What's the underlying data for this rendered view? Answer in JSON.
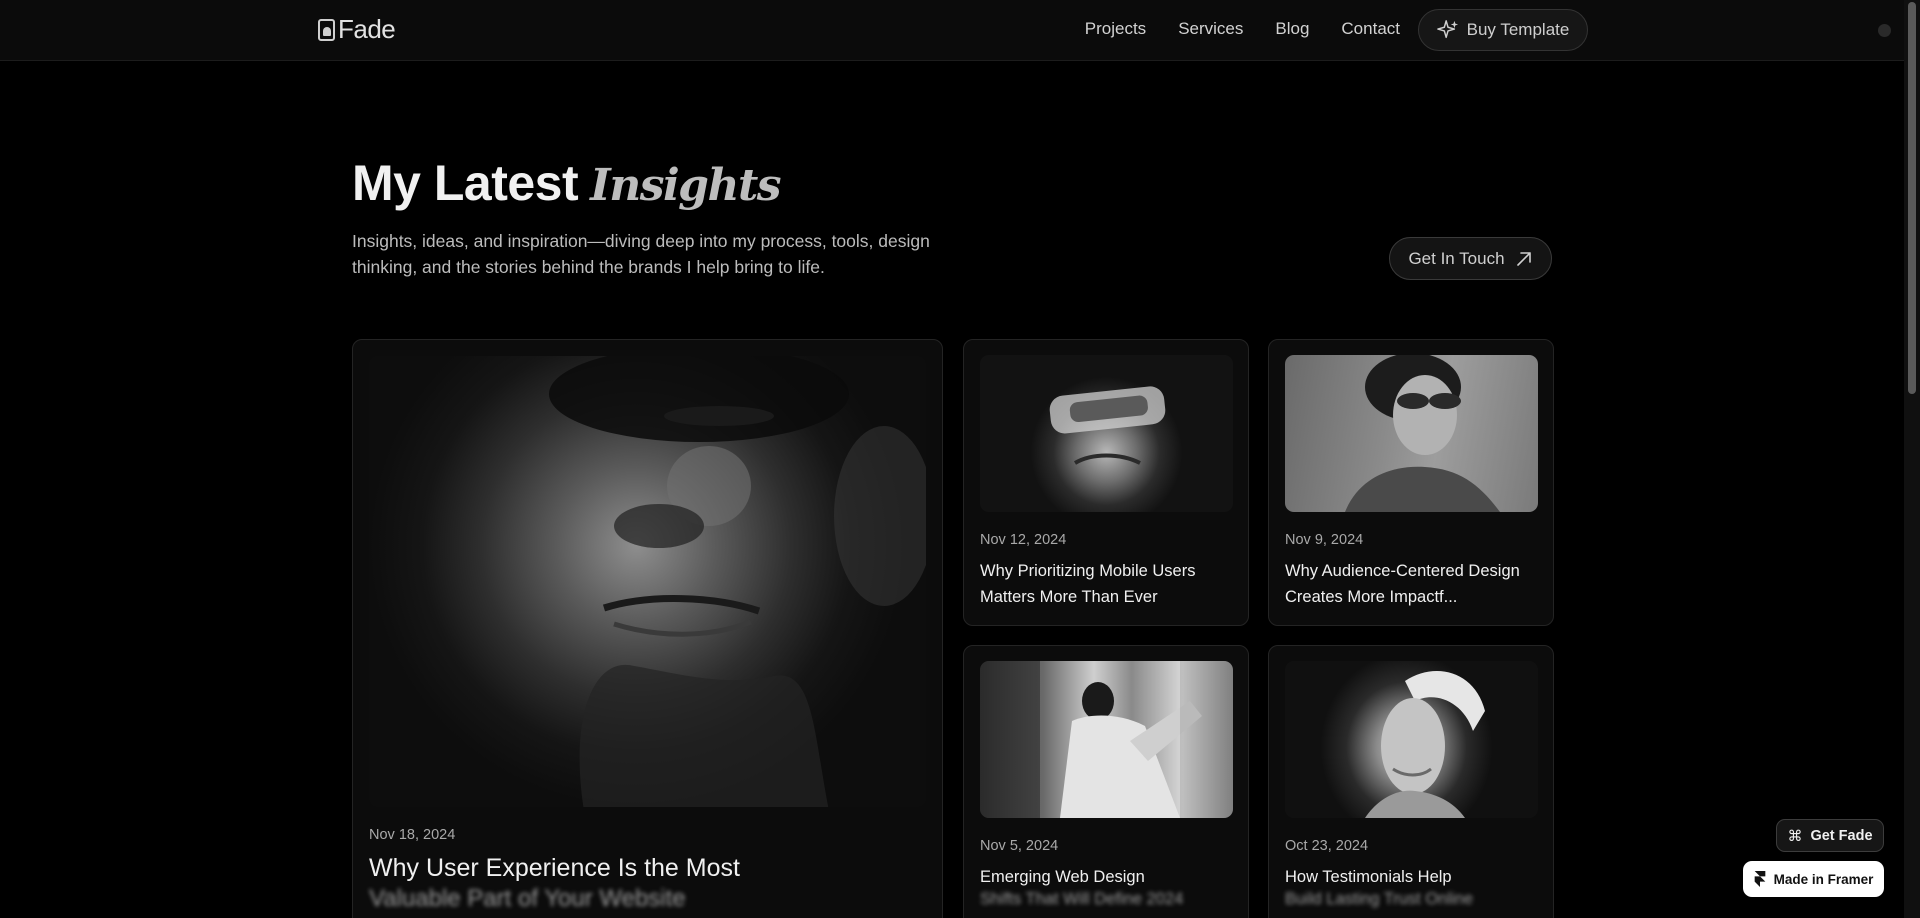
{
  "nav": {
    "logo_text": "Fade",
    "links": [
      "Projects",
      "Services",
      "Blog",
      "Contact"
    ],
    "buy_label": "Buy Template"
  },
  "header": {
    "title_plain": "My Latest",
    "title_accent": "Insights",
    "subtitle": "Insights, ideas, and inspiration—diving deep into my process, tools, design thinking, and the stories behind the brands I help bring to life.",
    "touch_label": "Get In Touch"
  },
  "posts": [
    {
      "date": "Nov 18, 2024",
      "title": "Why User Experience Is the Most",
      "title_faded": "Valuable Part of Your Website",
      "icon": "portrait-image"
    },
    {
      "date": "Nov 12, 2024",
      "title": "Why Prioritizing Mobile Users Matters More Than Ever",
      "icon": "visor-portrait-image"
    },
    {
      "date": "Nov 9, 2024",
      "title": "Why Audience-Centered Design Creates More Impactf...",
      "icon": "sunglasses-portrait-image"
    },
    {
      "date": "Nov 5, 2024",
      "title": "Emerging Web Design",
      "title_faded": "Shifts That Will Define 2024",
      "icon": "street-fashion-image"
    },
    {
      "date": "Oct 23, 2024",
      "title": "How Testimonials Help",
      "title_faded": "Build Lasting Trust Online",
      "icon": "bandana-portrait-image"
    }
  ],
  "badges": {
    "get_fade": "Get Fade",
    "made_in_framer": "Made in Framer"
  },
  "colors": {
    "background": "#000000",
    "nav_background": "#0b0b0b",
    "card_background": "#0c0c0c",
    "text_primary": "#f0f0f0",
    "text_secondary": "#a9a9a9"
  }
}
